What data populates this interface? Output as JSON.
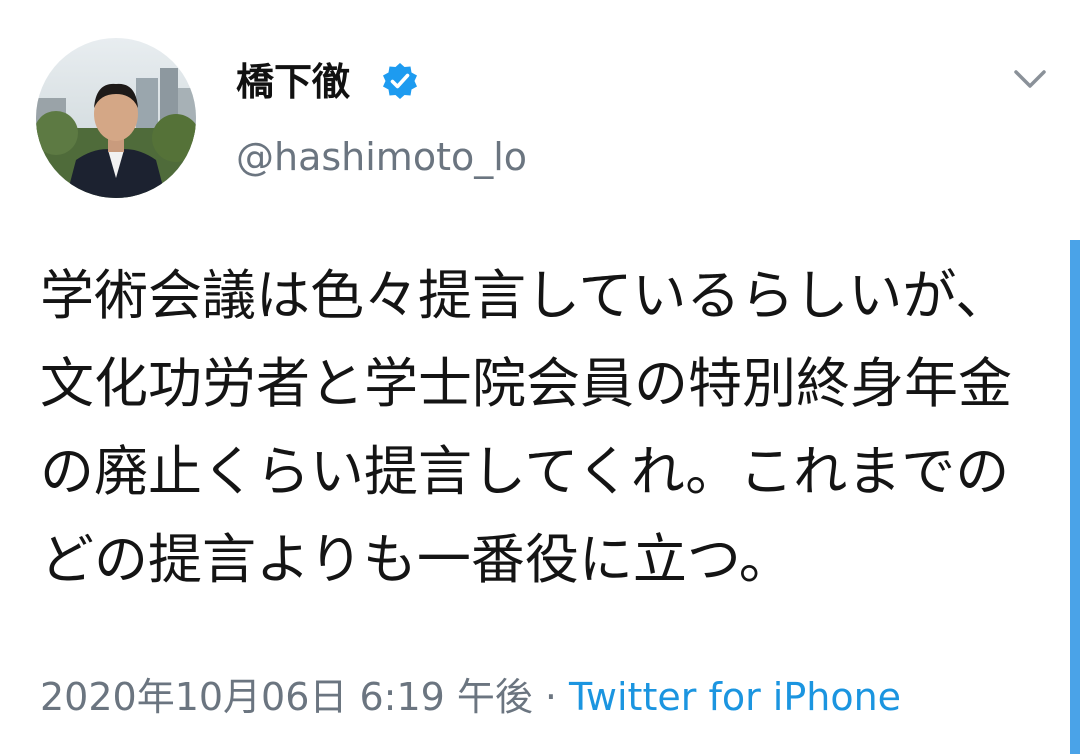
{
  "user": {
    "display_name": "橋下徹",
    "handle": "@hashimoto_lo",
    "verified": true
  },
  "tweet": {
    "text": "学術会議は色々提言しているらしいが、文化功労者と学士院会員の特別終身年金の廃止くらい提言してくれ。これまでのどの提言よりも一番役に立つ。",
    "timestamp": "2020年10月06日 6:19 午後",
    "separator": "·",
    "source": "Twitter for iPhone"
  },
  "icons": {
    "verified": "verified-badge-icon",
    "menu": "chevron-down-icon"
  },
  "colors": {
    "accent": "#1b95e0",
    "text": "#141414",
    "muted": "#6b7580"
  }
}
